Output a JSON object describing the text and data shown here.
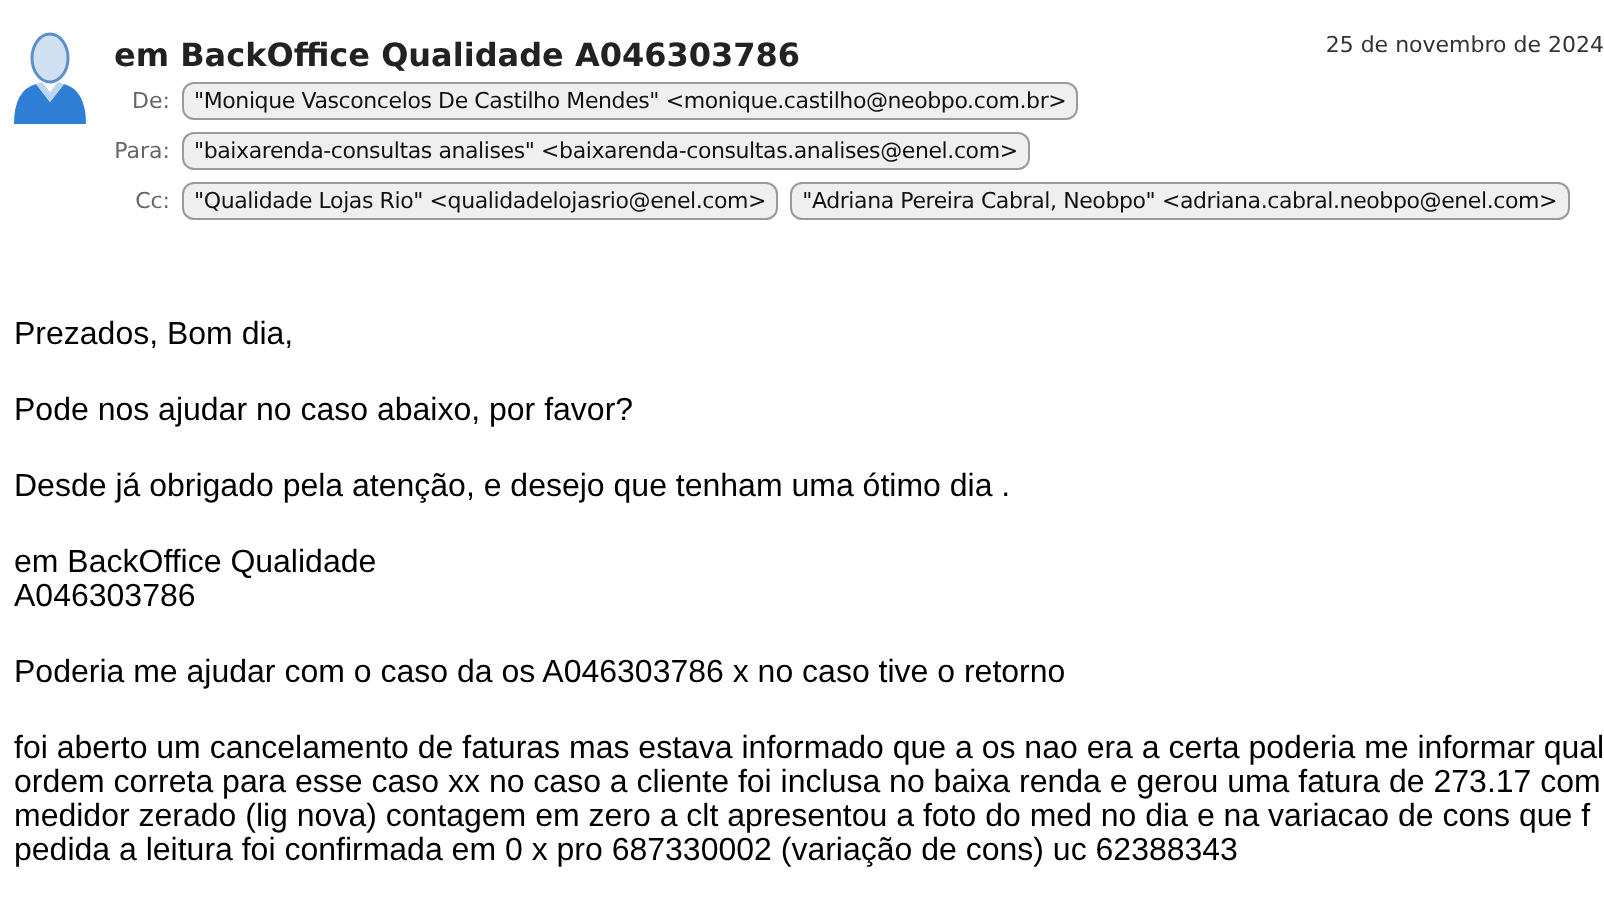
{
  "message": {
    "subject": "em BackOffice Qualidade A046303786",
    "date": "25 de novembro de 2024",
    "fields": [
      {
        "label": "De:",
        "recipients": [
          "\"Monique Vasconcelos De Castilho Mendes\" <monique.castilho@neobpo.com.br>"
        ]
      },
      {
        "label": "Para:",
        "recipients": [
          "\"baixarenda-consultas analises\" <baixarenda-consultas.analises@enel.com>"
        ]
      },
      {
        "label": "Cc:",
        "recipients": [
          "\"Qualidade Lojas Rio\" <qualidadelojasrio@enel.com>",
          "\"Adriana Pereira Cabral, Neobpo\" <adriana.cabral.neobpo@enel.com>"
        ]
      }
    ]
  },
  "body": [
    {
      "lines": [
        "Prezados, Bom dia,"
      ]
    },
    {
      "lines": [
        "Pode nos ajudar no caso abaixo, por favor?"
      ]
    },
    {
      "lines": [
        "Desde já obrigado pela atenção, e desejo que tenham uma ótimo dia ."
      ]
    },
    {
      "lines": [
        "em BackOffice Qualidade",
        "A046303786"
      ]
    },
    {
      "lines": [
        "Poderia me ajudar com o caso da os A046303786 x no caso tive o retorno"
      ]
    },
    {
      "lines": [
        "foi aberto um cancelamento de faturas mas estava informado que a os nao era a certa poderia me informar qual",
        "ordem correta para esse caso xx no caso a cliente foi inclusa no baixa renda e gerou uma fatura de 273.17  com",
        "medidor zerado (lig nova) contagem em zero a clt apresentou a foto do med no dia e na variacao de cons que f",
        "pedida a leitura foi confirmada em 0 x pro 687330002 (variação de cons)  uc 62388343"
      ]
    }
  ]
}
